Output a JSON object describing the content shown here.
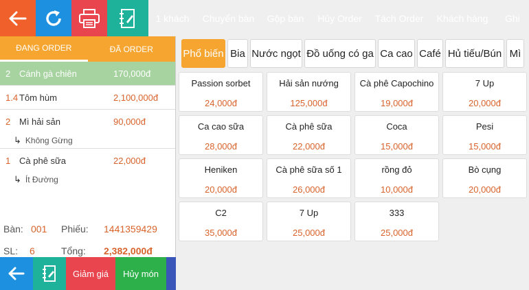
{
  "toolbar": {
    "buttons": [
      {
        "label": "1 khách",
        "color": "#4a5a7a"
      },
      {
        "label": "Chuyển bàn",
        "color": "#f0602a"
      },
      {
        "label": "Gộp bàn",
        "color": "#f5a530"
      },
      {
        "label": "Hủy Order",
        "color": "#7a4a3a"
      },
      {
        "label": "Tách Order",
        "color": "#3a56b8"
      },
      {
        "label": "Khách hàng",
        "color": "#9a5ab8"
      },
      {
        "label": "Ghi n",
        "color": "#29b06a"
      }
    ],
    "icons": {
      "back": "back-arrow-icon",
      "refresh": "refresh-icon",
      "print": "printer-icon",
      "note": "notebook-icon"
    }
  },
  "order_tabs": {
    "current": "ĐANG ORDER",
    "done": "ĐÃ ORDER"
  },
  "orders": [
    {
      "qty": "2",
      "name": "Cánh gà chiên",
      "price": "170,000đ",
      "note": ""
    },
    {
      "qty": "1.4",
      "name": "Tôm hùm",
      "price": "2,100,000đ",
      "note": ""
    },
    {
      "qty": "2",
      "name": "Mì hải sản",
      "price": "90,000đ",
      "note": "Không Gừng"
    },
    {
      "qty": "1",
      "name": "Cà phê sữa",
      "price": "22,000đ",
      "note": "Ít Đường"
    }
  ],
  "summary": {
    "table_label": "Bàn:",
    "table_value": "001",
    "ticket_label": "Phiếu:",
    "ticket_value": "1441359429",
    "count_label": "SL:",
    "count_value": "6",
    "total_label": "Tổng:",
    "total_value": "2,382,000đ"
  },
  "bottom": {
    "discount": "Giảm giá",
    "cancel_item": "Hủy món"
  },
  "categories": [
    "Phổ biến",
    "Bia",
    "Nước ngọt",
    "Đồ uống có ga",
    "Ca cao",
    "Café",
    "Hủ tiếu/Bún",
    "Mì"
  ],
  "menu": [
    {
      "name": "Passion sorbet",
      "price": "24,000đ"
    },
    {
      "name": "Hải sản nướng",
      "price": "125,000đ"
    },
    {
      "name": "Cà phê Capochino",
      "price": "19,000đ"
    },
    {
      "name": "7 Up",
      "price": "20,000đ"
    },
    {
      "name": "Ca cao sữa",
      "price": "28,000đ"
    },
    {
      "name": "Cà phê sữa",
      "price": "22,000đ"
    },
    {
      "name": "Coca",
      "price": "15,000đ"
    },
    {
      "name": "Pesi",
      "price": "15,000đ"
    },
    {
      "name": "Heniken",
      "price": "20,000đ"
    },
    {
      "name": "Cà phê sữa số 1",
      "price": "26,000đ"
    },
    {
      "name": "rồng đỏ",
      "price": "10,000đ"
    },
    {
      "name": "Bò cụng",
      "price": "20,000đ"
    },
    {
      "name": "C2",
      "price": "35,000đ"
    },
    {
      "name": "7 Up",
      "price": "25,000đ"
    },
    {
      "name": "333",
      "price": "25,000đ"
    }
  ]
}
